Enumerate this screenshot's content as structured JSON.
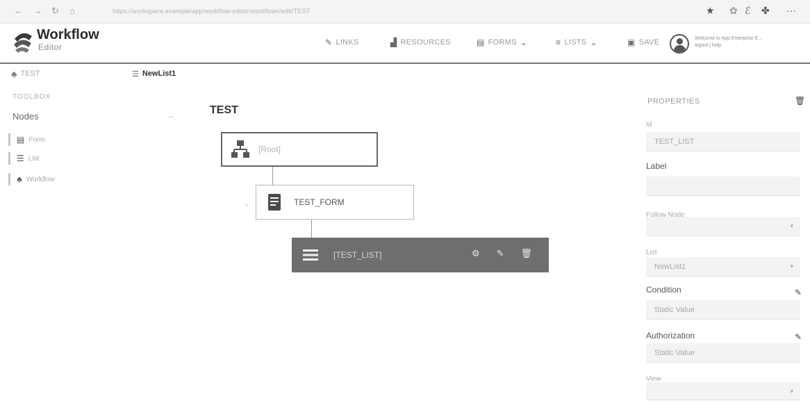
{
  "browser": {
    "url": "https://workspace.example/app/workflow-editor/workflows/edit/TEST"
  },
  "header": {
    "title": "Workflow",
    "subtitle": "Editor",
    "buttons": {
      "links": "LINKS",
      "resources": "RESOURCES",
      "forms": "FORMS",
      "lists": "LISTS",
      "save": "SAVE"
    },
    "welcome_line1": "Welcome to App Enterprise E...",
    "welcome_line2": "logout | help"
  },
  "tabs": [
    {
      "label": "TEST",
      "icon": "workflow-icon"
    },
    {
      "label": "NewList1",
      "icon": "list-icon"
    }
  ],
  "toolbox": {
    "title": "TOOLBOX",
    "section": "Nodes",
    "collapse": "–",
    "items": [
      {
        "label": "Form",
        "icon": "form-icon"
      },
      {
        "label": "List",
        "icon": "list-icon"
      },
      {
        "label": "Workflow",
        "icon": "workflow-icon"
      }
    ]
  },
  "canvas": {
    "title": "TEST",
    "nodes": [
      {
        "label": "[Root]",
        "icon": "workflow-icon"
      },
      {
        "label": "TEST_FORM",
        "icon": "form-icon"
      },
      {
        "label": "[TEST_LIST]",
        "icon": "list-icon"
      }
    ]
  },
  "properties": {
    "title": "PROPERTIES",
    "id_label": "Id",
    "id_value": "TEST_LIST",
    "label_label": "Label",
    "label_value": "",
    "follow_node_label": "Follow Node",
    "follow_node_value": "",
    "list_label": "List",
    "list_value": "NewList1",
    "condition_label": "Condition",
    "condition_value": "Static Value",
    "authorization_label": "Authorization",
    "authorization_value": "Static Value",
    "view_label": "View"
  }
}
